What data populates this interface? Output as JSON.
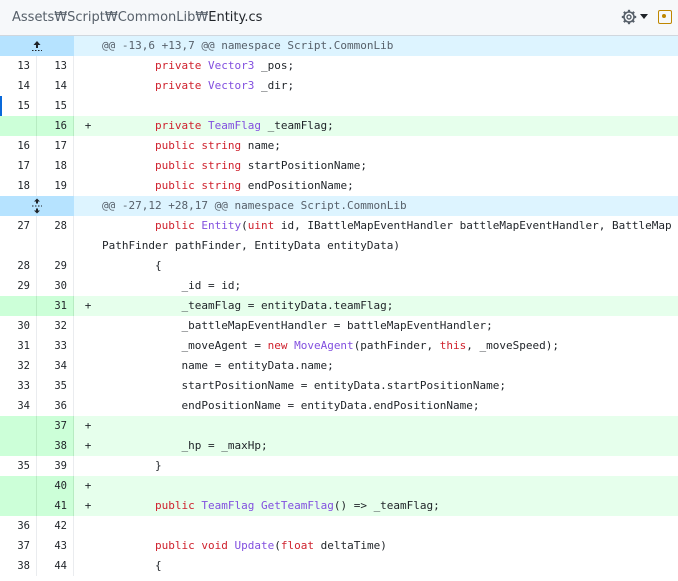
{
  "file": {
    "path_dirs": "Assets₩Script₩CommonLib₩",
    "path_name": "Entity.cs"
  },
  "hunks": [
    {
      "header": "@@ -13,6 +13,7 @@ namespace Script.CommonLib"
    },
    {
      "header": "@@ -27,12 +28,17 @@ namespace Script.CommonLib"
    }
  ],
  "lines_a": [
    {
      "old": "13",
      "new": "13",
      "marker": "",
      "indent": "        ",
      "parts": [
        [
          "kw",
          "private"
        ],
        [
          "t",
          " "
        ],
        [
          "tp",
          "Vector3"
        ],
        [
          "t",
          " _pos;"
        ]
      ]
    },
    {
      "old": "14",
      "new": "14",
      "marker": "",
      "indent": "        ",
      "parts": [
        [
          "kw",
          "private"
        ],
        [
          "t",
          " "
        ],
        [
          "tp",
          "Vector3"
        ],
        [
          "t",
          " _dir;"
        ]
      ]
    },
    {
      "old": "15",
      "new": "15",
      "marker": "",
      "indent": "",
      "parts": []
    },
    {
      "old": "",
      "new": "16",
      "marker": "+",
      "indent": "        ",
      "parts": [
        [
          "kw",
          "private"
        ],
        [
          "t",
          " "
        ],
        [
          "tp",
          "TeamFlag"
        ],
        [
          "t",
          " _teamFlag;"
        ]
      ]
    },
    {
      "old": "16",
      "new": "17",
      "marker": "",
      "indent": "        ",
      "parts": [
        [
          "kw",
          "public"
        ],
        [
          "t",
          " "
        ],
        [
          "kw",
          "string"
        ],
        [
          "t",
          " name;"
        ]
      ]
    },
    {
      "old": "17",
      "new": "18",
      "marker": "",
      "indent": "        ",
      "parts": [
        [
          "kw",
          "public"
        ],
        [
          "t",
          " "
        ],
        [
          "kw",
          "string"
        ],
        [
          "t",
          " startPositionName;"
        ]
      ]
    },
    {
      "old": "18",
      "new": "19",
      "marker": "",
      "indent": "        ",
      "parts": [
        [
          "kw",
          "public"
        ],
        [
          "t",
          " "
        ],
        [
          "kw",
          "string"
        ],
        [
          "t",
          " endPositionName;"
        ]
      ]
    }
  ],
  "lines_b": [
    {
      "old": "27",
      "new": "28",
      "marker": "",
      "indent": "        ",
      "parts": [
        [
          "kw",
          "public"
        ],
        [
          "t",
          " "
        ],
        [
          "fn",
          "Entity"
        ],
        [
          "t",
          "("
        ],
        [
          "kw",
          "uint"
        ],
        [
          "t",
          " id, IBattleMapEventHandler battleMapEventHandler, BattleMapPathFinder pathFinder, EntityData entityData)"
        ]
      ]
    },
    {
      "old": "28",
      "new": "29",
      "marker": "",
      "indent": "        ",
      "parts": [
        [
          "t",
          "{"
        ]
      ]
    },
    {
      "old": "29",
      "new": "30",
      "marker": "",
      "indent": "            ",
      "parts": [
        [
          "t",
          "_id = id;"
        ]
      ]
    },
    {
      "old": "",
      "new": "31",
      "marker": "+",
      "indent": "            ",
      "parts": [
        [
          "t",
          "_teamFlag = entityData.teamFlag;"
        ]
      ]
    },
    {
      "old": "30",
      "new": "32",
      "marker": "",
      "indent": "            ",
      "parts": [
        [
          "t",
          "_battleMapEventHandler = battleMapEventHandler;"
        ]
      ]
    },
    {
      "old": "31",
      "new": "33",
      "marker": "",
      "indent": "            ",
      "parts": [
        [
          "t",
          "_moveAgent = "
        ],
        [
          "kw",
          "new"
        ],
        [
          "t",
          " "
        ],
        [
          "tp",
          "MoveAgent"
        ],
        [
          "t",
          "(pathFinder, "
        ],
        [
          "kw",
          "this"
        ],
        [
          "t",
          ", _moveSpeed);"
        ]
      ]
    },
    {
      "old": "32",
      "new": "34",
      "marker": "",
      "indent": "            ",
      "parts": [
        [
          "t",
          "name = entityData.name;"
        ]
      ]
    },
    {
      "old": "33",
      "new": "35",
      "marker": "",
      "indent": "            ",
      "parts": [
        [
          "t",
          "startPositionName = entityData.startPositionName;"
        ]
      ]
    },
    {
      "old": "34",
      "new": "36",
      "marker": "",
      "indent": "            ",
      "parts": [
        [
          "t",
          "endPositionName = entityData.endPositionName;"
        ]
      ]
    },
    {
      "old": "",
      "new": "37",
      "marker": "+",
      "indent": "",
      "parts": []
    },
    {
      "old": "",
      "new": "38",
      "marker": "+",
      "indent": "            ",
      "parts": [
        [
          "t",
          "_hp = _maxHp;"
        ]
      ]
    },
    {
      "old": "35",
      "new": "39",
      "marker": "",
      "indent": "        ",
      "parts": [
        [
          "t",
          "}"
        ]
      ]
    },
    {
      "old": "",
      "new": "40",
      "marker": "+",
      "indent": "",
      "parts": []
    },
    {
      "old": "",
      "new": "41",
      "marker": "+",
      "indent": "        ",
      "parts": [
        [
          "kw",
          "public"
        ],
        [
          "t",
          " "
        ],
        [
          "tp",
          "TeamFlag"
        ],
        [
          "t",
          " "
        ],
        [
          "fn",
          "GetTeamFlag"
        ],
        [
          "t",
          "() => _teamFlag;"
        ]
      ]
    },
    {
      "old": "36",
      "new": "42",
      "marker": "",
      "indent": "",
      "parts": []
    },
    {
      "old": "37",
      "new": "43",
      "marker": "",
      "indent": "        ",
      "parts": [
        [
          "kw",
          "public"
        ],
        [
          "t",
          " "
        ],
        [
          "kw",
          "void"
        ],
        [
          "t",
          " "
        ],
        [
          "fn",
          "Update"
        ],
        [
          "t",
          "("
        ],
        [
          "kw",
          "float"
        ],
        [
          "t",
          " deltaTime)"
        ]
      ]
    },
    {
      "old": "38",
      "new": "44",
      "marker": "",
      "indent": "        ",
      "parts": [
        [
          "t",
          "{"
        ]
      ]
    }
  ]
}
